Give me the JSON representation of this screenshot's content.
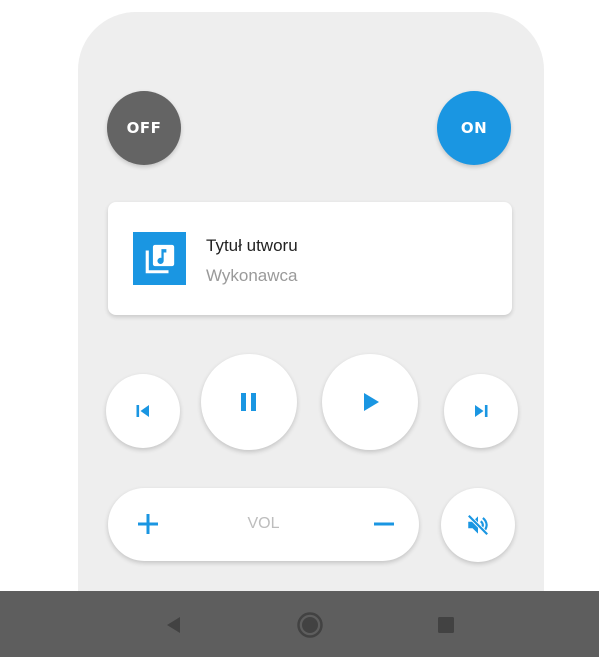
{
  "power": {
    "off_label": "OFF",
    "on_label": "ON"
  },
  "media": {
    "title": "Tytuł utworu",
    "artist": "Wykonawca",
    "cover_icon": "music-library-icon"
  },
  "transport": {
    "prev_icon": "skip-previous-icon",
    "pause_icon": "pause-icon",
    "play_icon": "play-icon",
    "next_icon": "skip-next-icon"
  },
  "volume": {
    "label": "VOL",
    "up_icon": "plus-icon",
    "down_icon": "minus-icon",
    "mute_icon": "volume-mute-icon"
  },
  "system_nav": {
    "back_icon": "back-triangle-icon",
    "home_icon": "home-circle-icon",
    "recent_icon": "recent-square-icon"
  },
  "colors": {
    "accent": "#1a96e2",
    "off_button": "#646464",
    "panel": "#eeeeee",
    "navbar": "#5e5e5e"
  }
}
